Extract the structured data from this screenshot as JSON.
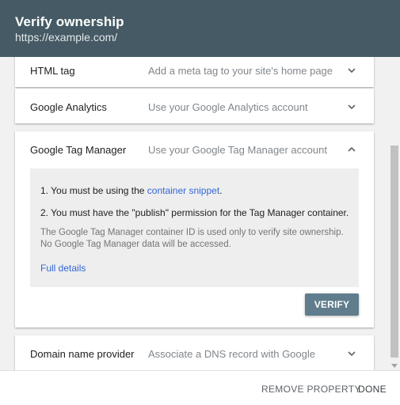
{
  "dialog": {
    "title": "Verify ownership",
    "url": "https://example.com/"
  },
  "methods": [
    {
      "label": "HTML tag",
      "description": "Add a meta tag to your site's home page",
      "expanded": false,
      "icon": "chevron-down-icon"
    },
    {
      "label": "Google Analytics",
      "description": "Use your Google Analytics account",
      "expanded": false,
      "icon": "chevron-down-icon"
    },
    {
      "label": "Google Tag Manager",
      "description": "Use your Google Tag Manager account",
      "expanded": true,
      "icon": "chevron-up-icon"
    },
    {
      "label": "Domain name provider",
      "description": "Associate a DNS record with Google",
      "expanded": false,
      "icon": "chevron-down-icon"
    }
  ],
  "gtm_panel": {
    "step1_prefix": "1. You must be using the ",
    "step1_link": "container snippet",
    "step1_suffix": ".",
    "step2": "2. You must have the \"publish\" permission for the Tag Manager container.",
    "note": "The Google Tag Manager container ID is used only to verify site ownership. No Google Tag Manager data will be accessed.",
    "details_link": "Full details",
    "verify_label": "VERIFY"
  },
  "footer": {
    "remove_label": "REMOVE PROPERTY",
    "done_label": "DONE"
  },
  "colors": {
    "header_bg": "#455a64",
    "link": "#3367d6",
    "verify_bg": "#5f7d8c"
  }
}
